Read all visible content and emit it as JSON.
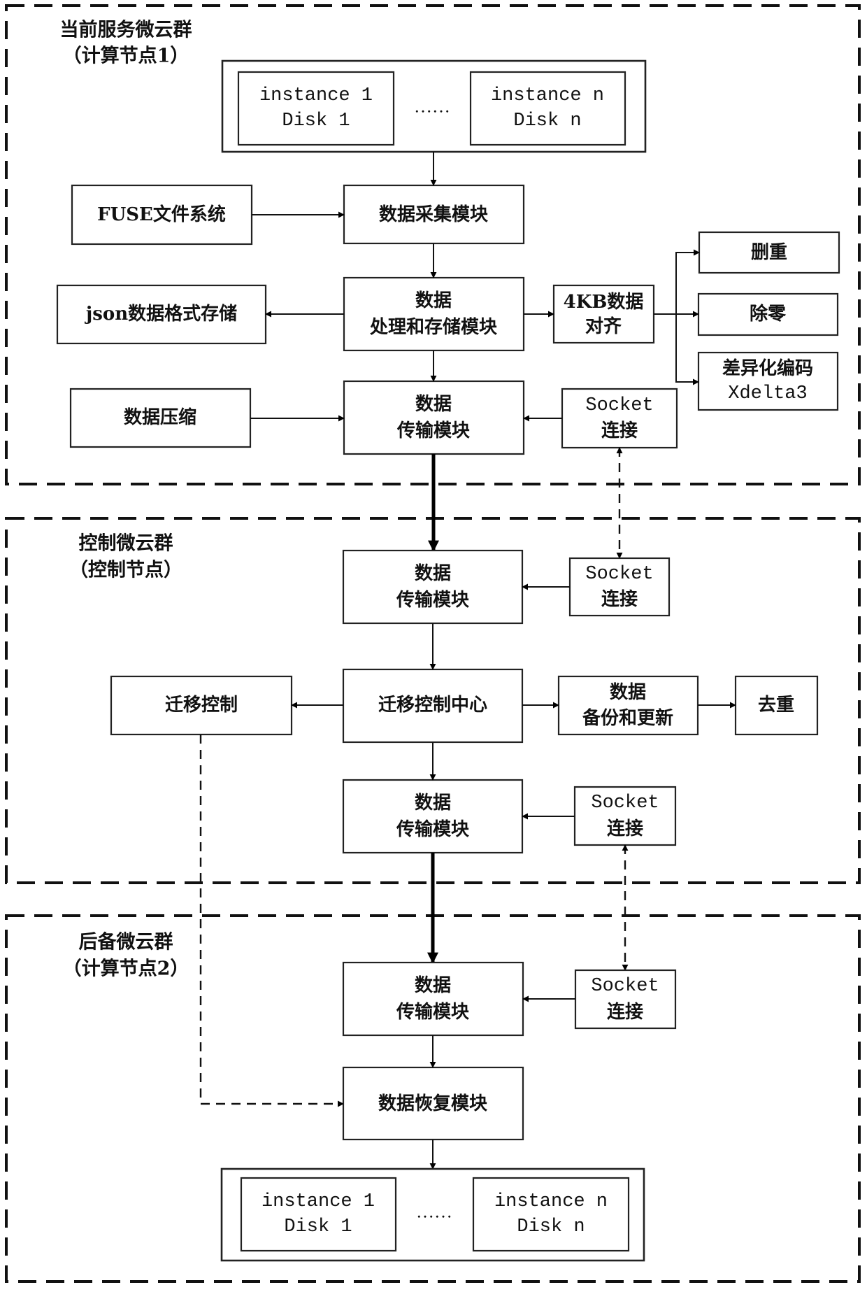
{
  "sections": [
    {
      "title": "当前服务微云群",
      "subtitle": "（计算节点1）"
    },
    {
      "title": "控制微云群",
      "subtitle": "（控制节点）"
    },
    {
      "title": "后备微云群",
      "subtitle": "（计算节点2）"
    }
  ],
  "source_instances": {
    "first": [
      "instance 1",
      "Disk 1"
    ],
    "ellipsis": "……",
    "last": [
      "instance n",
      "Disk n"
    ]
  },
  "target_instances": {
    "first": [
      "instance 1",
      "Disk 1"
    ],
    "ellipsis": "……",
    "last": [
      "instance n",
      "Disk n"
    ]
  },
  "nodes": {
    "fuse": [
      "FUSE文件系统"
    ],
    "collect": [
      "数据采集模块"
    ],
    "json_store": [
      "json数据格式存储"
    ],
    "process": [
      "数据",
      "处理和存储模块"
    ],
    "align": [
      "4KB数据",
      "对齐"
    ],
    "dedup": [
      "删重"
    ],
    "zero": [
      "除零"
    ],
    "xdelta": [
      "差异化编码",
      "Xdelta3"
    ],
    "compress": [
      "数据压缩"
    ],
    "transfer1": [
      "数据",
      "传输模块"
    ],
    "socket1": [
      "Socket",
      "连接"
    ],
    "transfer2": [
      "数据",
      "传输模块"
    ],
    "socket2": [
      "Socket",
      "连接"
    ],
    "migrate_ctrl": [
      "迁移控制"
    ],
    "migrate_center": [
      "迁移控制中心"
    ],
    "backup": [
      "数据",
      "备份和更新"
    ],
    "dedup2": [
      "去重"
    ],
    "transfer3": [
      "数据",
      "传输模块"
    ],
    "socket3": [
      "Socket",
      "连接"
    ],
    "transfer4": [
      "数据",
      "传输模块"
    ],
    "socket4": [
      "Socket",
      "连接"
    ],
    "restore": [
      "数据恢复模块"
    ]
  }
}
